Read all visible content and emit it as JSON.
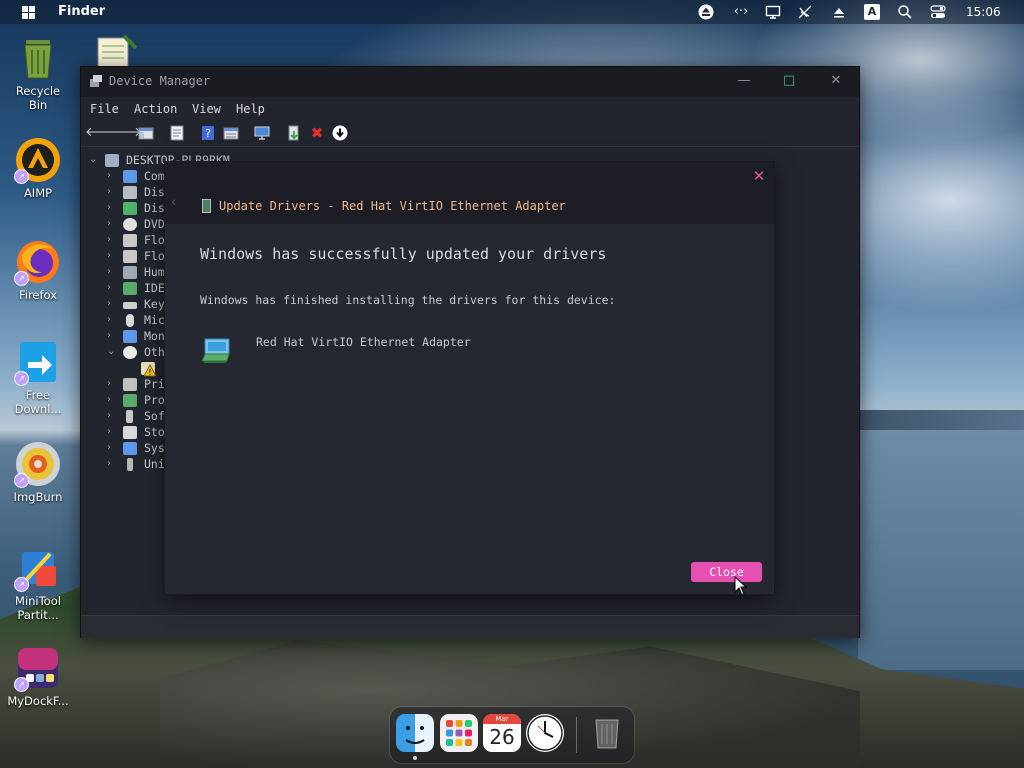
{
  "topbar": {
    "app_name": "Finder",
    "clock": "15:06",
    "tray_icons": [
      "eject-icon",
      "code-icon",
      "display-icon",
      "network-off-icon",
      "triangle-up-icon",
      "keyboard-a-icon",
      "search-icon",
      "toggle-icon"
    ]
  },
  "desktop": {
    "icons": [
      {
        "name": "recycle-bin",
        "label_line1": "Recycle",
        "label_line2": "Bin"
      },
      {
        "name": "aimp",
        "label_line1": "AIMP",
        "label_line2": ""
      },
      {
        "name": "firefox",
        "label_line1": "Firefox",
        "label_line2": ""
      },
      {
        "name": "free-download-manager",
        "label_line1": "Free",
        "label_line2": "Downl..."
      },
      {
        "name": "imgburn",
        "label_line1": "ImgBurn",
        "label_line2": ""
      },
      {
        "name": "minitool",
        "label_line1": "MiniTool",
        "label_line2": "Partit..."
      },
      {
        "name": "mydockfinder",
        "label_line1": "MyDockF...",
        "label_line2": ""
      }
    ]
  },
  "device_manager": {
    "title": "Device Manager",
    "menu": [
      "File",
      "Action",
      "View",
      "Help"
    ],
    "root": "DESKTOP-PLR9RKM",
    "tree": [
      "Com",
      "Dis",
      "Dis",
      "DVD",
      "Flo",
      "Flo",
      "Hum",
      "IDE",
      "Key",
      "Mic",
      "Mon",
      "Oth",
      "",
      "Pri",
      "Pro",
      "Sof",
      "Sto",
      "Sys",
      "Uni"
    ]
  },
  "dialog": {
    "title": "Update Drivers - Red Hat VirtIO Ethernet Adapter",
    "heading": "Windows has successfully updated your drivers",
    "description": "Windows has finished installing the drivers for this device:",
    "device_name": "Red Hat VirtIO Ethernet Adapter",
    "close_label": "Close"
  },
  "dock": {
    "calendar_month": "Mar",
    "calendar_day": "26"
  },
  "colors": {
    "accent": "#e64fb2",
    "dialog_title": "#f0b98a",
    "close_x": "#e0568f"
  }
}
